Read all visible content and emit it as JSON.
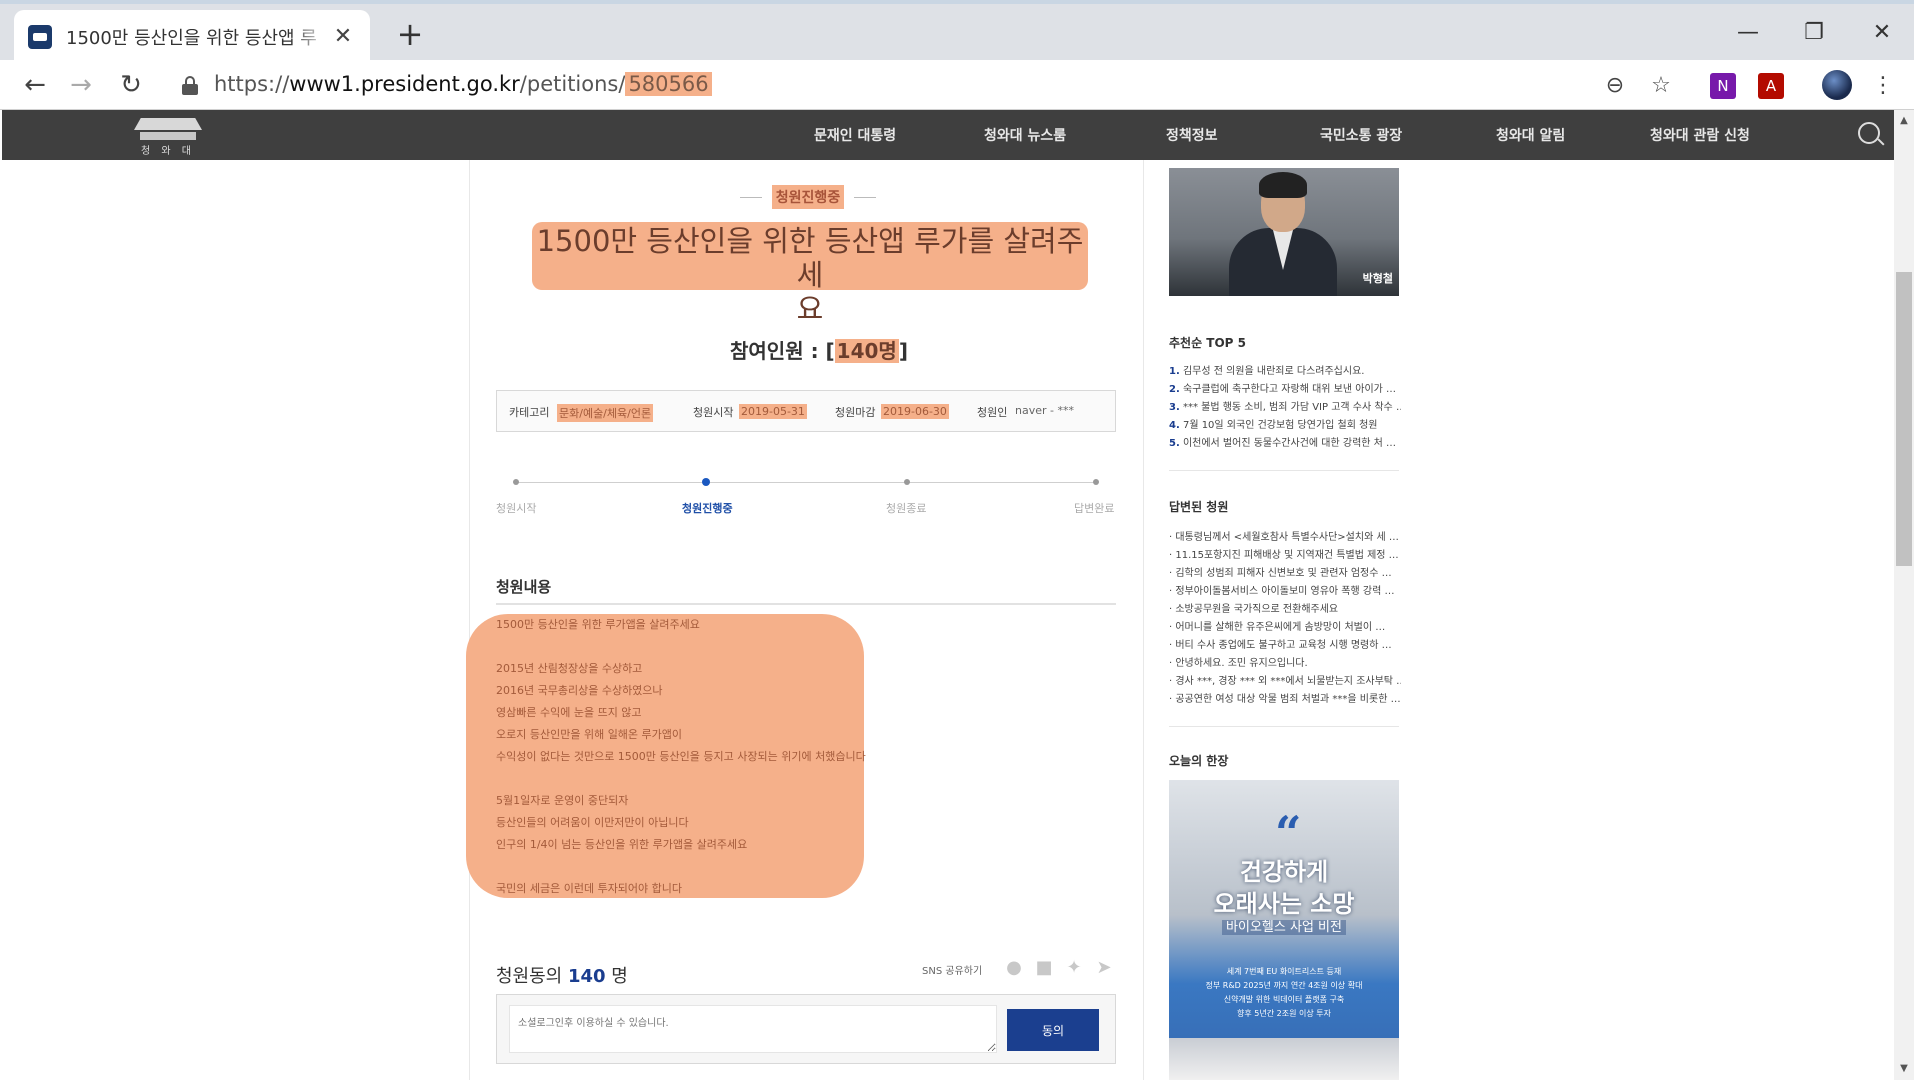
{
  "browser": {
    "tab_title": "1500만 등산인을 위한 등산앱 루",
    "url_prefix": "https://",
    "url_host": "www1.president.go.kr",
    "url_path": "/petitions/",
    "url_highlight": "580566"
  },
  "sitenav": {
    "logo_text": "청 와 대",
    "items": [
      "문재인 대통령",
      "청와대 뉴스룸",
      "정책정보",
      "국민소통 광장",
      "청와대 알림",
      "청와대 관람 신청"
    ]
  },
  "petition": {
    "status": "청원진행중",
    "title_line1": "1500만 등산인을 위한 등산앱 루가를 살려주세",
    "title_line2": "요",
    "participants_label": "참여인원 : [",
    "participants_value": "140명",
    "participants_close": "]",
    "info": {
      "category_label": "카테고리",
      "category_value": "문화/예술/체육/언론",
      "start_label": "청원시작",
      "start_value": "2019-05-31",
      "end_label": "청원마감",
      "end_value": "2019-06-30",
      "author_label": "청원인",
      "author_value": "naver - ***"
    },
    "steps": [
      "청원시작",
      "청원진행중",
      "청원종료",
      "답변완료"
    ],
    "content_title": "청원내용",
    "content_lines": [
      "1500만 등산인을 위한 루가앱을 살려주세요",
      "2015년 산림청장상을 수상하고",
      "2016년 국무총리상을 수상하였으나",
      "영삼빠른 수익에 눈을 뜨지 않고",
      "오로지 등산인만을 위해 일해온 루가앱이",
      "수익성이 없다는 것만으로 1500만 등산인을 등지고 사장되는 위기에 처했습니다",
      "5월1일자로 운영이 중단되자",
      "등산인들의 어려움이 이만저만이 아닙니다",
      "인구의 1/4이 넘는 등산인을 위한 루가앱을 살려주세요",
      "국민의 세금은 이런데 투자되어야 합니다"
    ],
    "agree_title_prefix": "청원동의",
    "agree_count": "140",
    "agree_unit": "명",
    "sns_label": "SNS 공유하기",
    "comment_placeholder": "소셜로그인후 이용하실 수 있습니다.",
    "agree_button": "동의"
  },
  "sidebar": {
    "video_caption": "박형철",
    "top5_title": "추천순 TOP 5",
    "top5": [
      {
        "num": "1.",
        "text": "김무성 전 의원을 내란죄로 다스려주십시요."
      },
      {
        "num": "2.",
        "text": "숙구클럽에 축구한다고 자랑해 대위 보낸 아이가 …"
      },
      {
        "num": "3.",
        "text": "*** 불법 행동 소비, 범죄 가담 VIP 고객 수사 착수 …"
      },
      {
        "num": "4.",
        "text": "7월 10일 외국인 건강보험 당연가입 철회 청원"
      },
      {
        "num": "5.",
        "text": "이천에서 벌어진 동물수간사건에 대한 강력한 처 …"
      }
    ],
    "answered_title": "답변된 청원",
    "answered": [
      "대통령님께서 <세월호참사 특별수사단>설치와 세 …",
      "11.15포항지진 피해배상 및 지역재건 특별법 제정 …",
      "김학의 성범죄 피해자 신변보호 및 관련자 엄정수 …",
      "정부아이돌봄서비스 아이돌보미 영유아 폭행 강력 …",
      "소방공무원을 국가직으로 전환해주세요",
      "어머니를 살해한 유주은씨에게 솜방망이 처벌이 …",
      "버티 수사 종업에도 불구하고 교육청 시행 명령하 …",
      "안녕하세요. 조민 유지으입니다.",
      "경사 ***, 경장 *** 외 ***에서 뇌물받는지 조사부탁 …",
      "공공연한 여성 대상 악물 범죄 처벌과 ***을 비롯한 …"
    ],
    "today_title": "오늘의 한장",
    "today_quote": "“",
    "today_big1": "건강하게",
    "today_big2": "오래사는 소망",
    "today_sub": "바이오헬스 사업 비전",
    "today_small1": "세계 7번째 EU 화이트리스트 등재",
    "today_small2": "정부 R&D 2025년 까지 연간 4조원 이상 확대",
    "today_small3": "신약개발 위한 빅데이터 플랫폼 구축",
    "today_small4": "향후 5년간 2조원 이상 투자"
  }
}
